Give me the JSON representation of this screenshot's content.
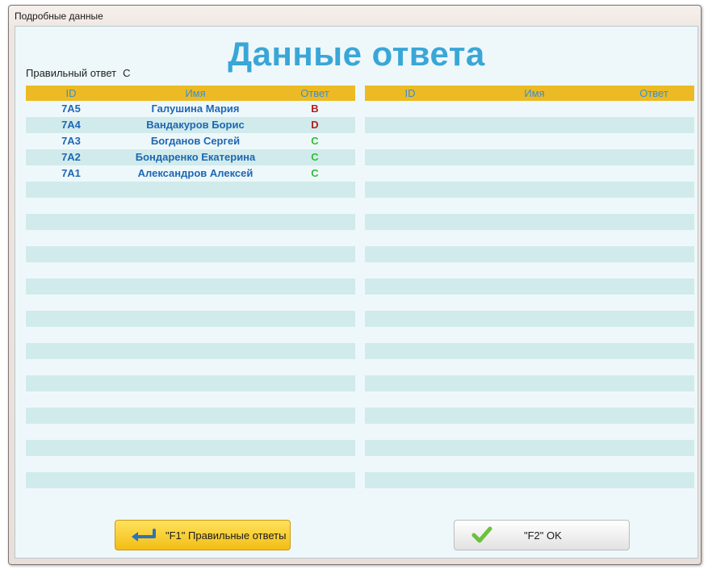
{
  "window": {
    "title": "Подробные данные"
  },
  "heading": "Данные ответа",
  "correct_answer": {
    "label": "Правильный ответ",
    "value": "C"
  },
  "left_table": {
    "headers": [
      "ID",
      "Имя",
      "Ответ"
    ],
    "rows": [
      {
        "id": "7A5",
        "name": "Галушина Мария",
        "answer": "B"
      },
      {
        "id": "7A4",
        "name": "Вандакуров Борис",
        "answer": "D"
      },
      {
        "id": "7A3",
        "name": "Богданов Сергей",
        "answer": "C"
      },
      {
        "id": "7A2",
        "name": "Бондаренко Екатерина",
        "answer": "C"
      },
      {
        "id": "7A1",
        "name": "Александров Алексей",
        "answer": "C"
      }
    ]
  },
  "right_table": {
    "headers": [
      "ID",
      "Имя",
      "Ответ"
    ],
    "rows": []
  },
  "buttons": {
    "f1": {
      "label": "\"F1\" Правильные ответы",
      "icon": "return-arrow-icon"
    },
    "f2": {
      "label": "\"F2\" OK",
      "icon": "checkmark-icon"
    }
  },
  "colors": {
    "header_bg": "#ecba24",
    "title": "#3aa6d7",
    "wrong": "#b41d1d",
    "correct": "#2fbf35"
  }
}
